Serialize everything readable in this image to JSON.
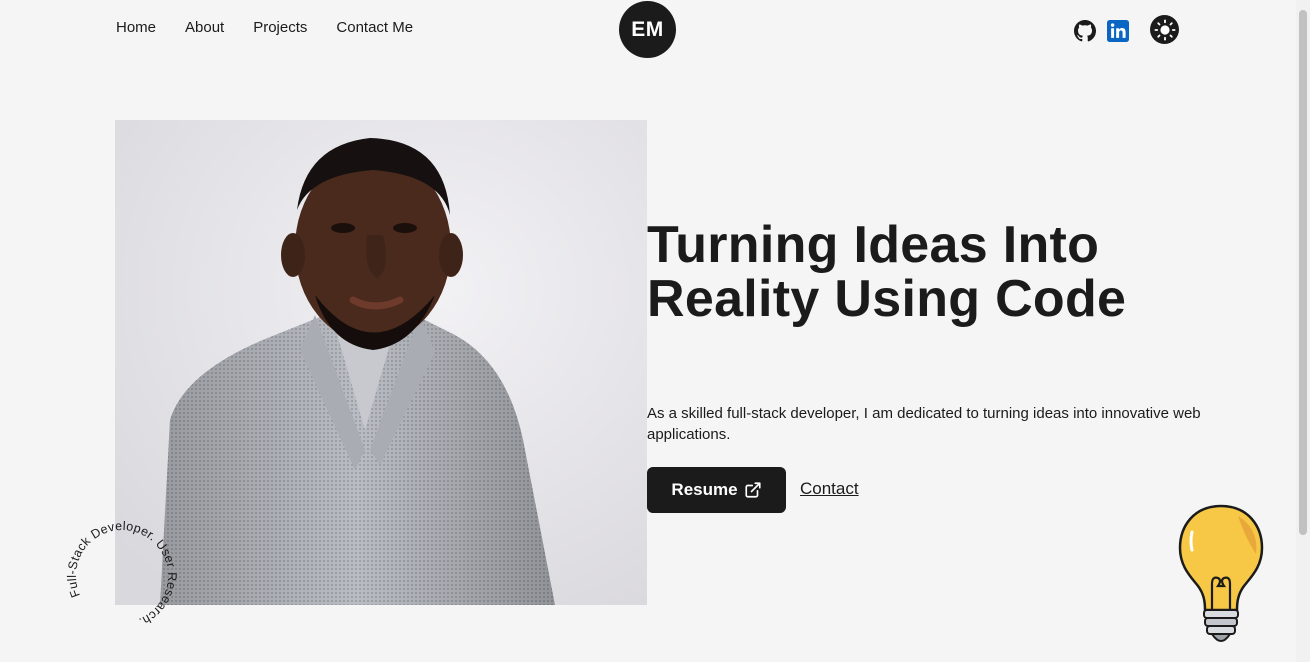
{
  "nav": {
    "links": [
      "Home",
      "About",
      "Projects",
      "Contact Me"
    ],
    "logo_text": "EM",
    "social": [
      "github-icon",
      "linkedin-icon"
    ],
    "theme_toggle_icon": "sun-icon"
  },
  "hero": {
    "title": "Turning Ideas Into Reality Using Code",
    "description": "As a skilled full-stack developer, I am dedicated to turning ideas into innovative web applications.",
    "resume_label": "Resume",
    "resume_icon": "external-link-icon",
    "contact_label": "Contact",
    "circular_text": "Full-Stack Developer. User Research."
  },
  "colors": {
    "background": "#f5f5f5",
    "dark": "#1b1b1b",
    "linkedin": "#0a66c2",
    "bulb": "#f7c846"
  }
}
